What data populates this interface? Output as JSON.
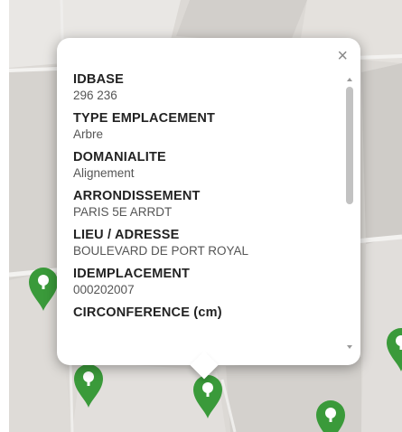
{
  "popup": {
    "close_icon": "close-icon",
    "fields": [
      {
        "key": "IDBASE",
        "value": "296 236"
      },
      {
        "key": "TYPE EMPLACEMENT",
        "value": "Arbre"
      },
      {
        "key": "DOMANIALITE",
        "value": "Alignement"
      },
      {
        "key": "ARRONDISSEMENT",
        "value": "PARIS 5E ARRDT"
      },
      {
        "key": "LIEU / ADRESSE",
        "value": "BOULEVARD DE PORT ROYAL"
      },
      {
        "key": "IDEMPLACEMENT",
        "value": "000202007"
      },
      {
        "key": "CIRCONFERENCE (cm)",
        "value": ""
      }
    ],
    "close_glyph": "×"
  },
  "colors": {
    "marker": "#3a9a3a",
    "map_background": "#d9d6d2"
  },
  "markers": [
    {
      "icon": "tree-marker-icon"
    },
    {
      "icon": "tree-marker-icon"
    },
    {
      "icon": "tree-marker-icon"
    },
    {
      "icon": "tree-marker-icon"
    },
    {
      "icon": "tree-marker-icon"
    }
  ]
}
